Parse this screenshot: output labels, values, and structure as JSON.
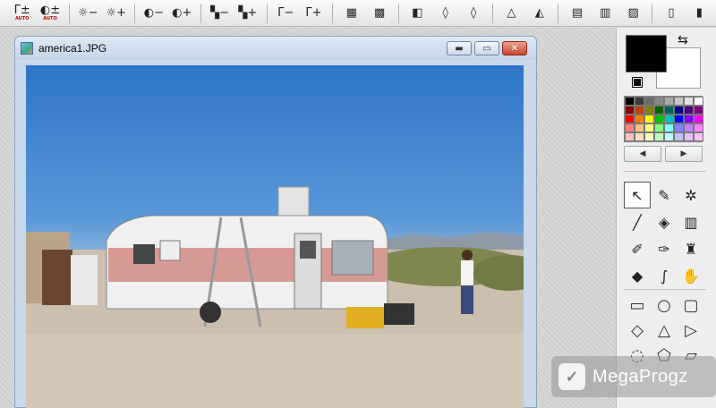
{
  "window": {
    "title": "america1.JPG"
  },
  "toolbar": {
    "groups": [
      [
        {
          "icon": "gamma-auto-icon",
          "glyph": "Γ±",
          "sub": "AUTO"
        },
        {
          "icon": "contrast-auto-icon",
          "glyph": "◐±",
          "sub": "AUTO"
        }
      ],
      [
        {
          "icon": "brightness-decrease-icon",
          "glyph": "☼−"
        },
        {
          "icon": "brightness-increase-icon",
          "glyph": "☼+"
        }
      ],
      [
        {
          "icon": "contrast-decrease-icon",
          "glyph": "◐−"
        },
        {
          "icon": "contrast-increase-icon",
          "glyph": "◐+"
        }
      ],
      [
        {
          "icon": "color-decrease-icon",
          "glyph": "▚−"
        },
        {
          "icon": "color-increase-icon",
          "glyph": "▚+"
        }
      ],
      [
        {
          "icon": "gamma-decrease-icon",
          "glyph": "Γ−"
        },
        {
          "icon": "gamma-increase-icon",
          "glyph": "Γ+"
        }
      ],
      [
        {
          "icon": "mosaic-icon",
          "glyph": "▦"
        },
        {
          "icon": "texture-icon",
          "glyph": "▩"
        }
      ],
      [
        {
          "icon": "mirror-icon",
          "glyph": "◧"
        },
        {
          "icon": "drop-icon",
          "glyph": "◊"
        },
        {
          "icon": "drop-outline-icon",
          "glyph": "◊"
        }
      ],
      [
        {
          "icon": "sharpen-icon",
          "glyph": "△"
        },
        {
          "icon": "sharpen-more-icon",
          "glyph": "◭"
        }
      ],
      [
        {
          "icon": "color-balance-icon",
          "glyph": "▤"
        },
        {
          "icon": "gradient-icon",
          "glyph": "▥"
        },
        {
          "icon": "effect-icon",
          "glyph": "▨"
        }
      ],
      [
        {
          "icon": "page-icon",
          "glyph": "▯"
        },
        {
          "icon": "copy-page-icon",
          "glyph": "▮"
        }
      ]
    ]
  },
  "panel": {
    "foreground_color": "#000000",
    "background_color": "#ffffff",
    "palette": [
      "#000000",
      "#3a3a3a",
      "#6a6a6a",
      "#8a8a8a",
      "#a8a8a8",
      "#c8c8c8",
      "#e2e2e2",
      "#ffffff",
      "#8b0000",
      "#c04000",
      "#808000",
      "#006400",
      "#006060",
      "#00008b",
      "#4b0082",
      "#800080",
      "#ff0000",
      "#ff8000",
      "#ffff00",
      "#00c000",
      "#00c0c0",
      "#0000ff",
      "#8000ff",
      "#ff00ff",
      "#ff8080",
      "#ffc080",
      "#ffff80",
      "#80ff80",
      "#80ffff",
      "#8080ff",
      "#c080ff",
      "#ff80ff",
      "#ffc0c0",
      "#ffe0c0",
      "#ffffc0",
      "#c0ffc0",
      "#c0ffff",
      "#c0c0ff",
      "#e0c0ff",
      "#ffc0ff"
    ],
    "tools": [
      {
        "icon": "select-arrow-icon",
        "glyph": "↖",
        "active": true
      },
      {
        "icon": "eyedropper-icon",
        "glyph": "✎"
      },
      {
        "icon": "magic-wand-icon",
        "glyph": "✲"
      },
      {
        "icon": "line-icon",
        "glyph": "╱"
      },
      {
        "icon": "fill-bucket-icon",
        "glyph": "◈"
      },
      {
        "icon": "spray-icon",
        "glyph": "▥"
      },
      {
        "icon": "pencil-icon",
        "glyph": "✐"
      },
      {
        "icon": "brush-icon",
        "glyph": "✑"
      },
      {
        "icon": "stamp-icon",
        "glyph": "♜"
      },
      {
        "icon": "drop-icon",
        "glyph": "◆"
      },
      {
        "icon": "smudge-icon",
        "glyph": "∫"
      },
      {
        "icon": "hand-icon",
        "glyph": "✋"
      }
    ],
    "shapes": [
      {
        "icon": "rectangle-icon",
        "glyph": "▭"
      },
      {
        "icon": "ellipse-icon",
        "glyph": "○"
      },
      {
        "icon": "rounded-rect-icon",
        "glyph": "▢"
      },
      {
        "icon": "diamond-icon",
        "glyph": "◇"
      },
      {
        "icon": "triangle-icon",
        "glyph": "△"
      },
      {
        "icon": "right-triangle-icon",
        "glyph": "▷"
      },
      {
        "icon": "lasso-icon",
        "glyph": "◌"
      },
      {
        "icon": "polygon-icon",
        "glyph": "⬠"
      },
      {
        "icon": "open-folder-icon",
        "glyph": "▱"
      }
    ]
  },
  "watermark": {
    "text": "MegaProgz"
  }
}
